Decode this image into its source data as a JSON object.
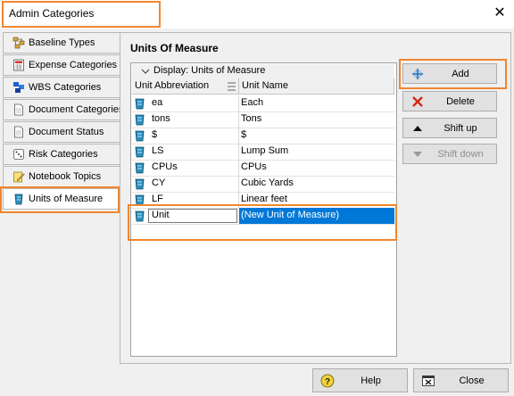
{
  "window": {
    "title": "Admin Categories",
    "close_glyph": "✕"
  },
  "sidebar": {
    "items": [
      {
        "label": "Baseline Types",
        "icon": "baseline-types-icon"
      },
      {
        "label": "Expense Categories",
        "icon": "expense-categories-icon"
      },
      {
        "label": "WBS Categories",
        "icon": "wbs-categories-icon"
      },
      {
        "label": "Document Categories",
        "icon": "document-categories-icon"
      },
      {
        "label": "Document Status",
        "icon": "document-status-icon"
      },
      {
        "label": "Risk Categories",
        "icon": "risk-categories-icon"
      },
      {
        "label": "Notebook Topics",
        "icon": "notebook-topics-icon"
      },
      {
        "label": "Units of Measure",
        "icon": "units-of-measure-icon",
        "selected": true
      }
    ]
  },
  "panel": {
    "heading": "Units Of Measure",
    "display_label": "Display: Units of Measure",
    "columns": [
      "Unit Abbreviation",
      "Unit Name"
    ],
    "rows": [
      {
        "abbr": "ea",
        "name": "Each"
      },
      {
        "abbr": "tons",
        "name": "Tons"
      },
      {
        "abbr": "$",
        "name": "$"
      },
      {
        "abbr": "LS",
        "name": "Lump Sum"
      },
      {
        "abbr": "CPUs",
        "name": "CPUs"
      },
      {
        "abbr": "CY",
        "name": "Cubic Yards"
      },
      {
        "abbr": "LF",
        "name": "Linear feet"
      }
    ],
    "new_row": {
      "abbr": "Unit",
      "name": "(New Unit of Measure)"
    }
  },
  "actions": {
    "add": "Add",
    "delete": "Delete",
    "shift_up": "Shift up",
    "shift_down": "Shift down"
  },
  "footer": {
    "help": "Help",
    "close": "Close"
  },
  "colors": {
    "highlight": "#f0862f",
    "selection": "#0078d7"
  }
}
